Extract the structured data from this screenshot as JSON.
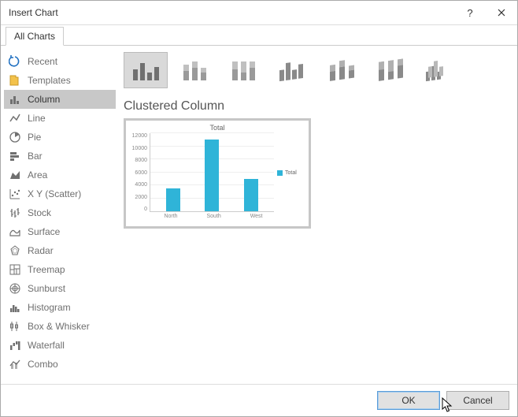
{
  "title": "Insert Chart",
  "tabs": {
    "main": "All Charts"
  },
  "sidebar": {
    "items": [
      {
        "label": "Recent"
      },
      {
        "label": "Templates"
      },
      {
        "label": "Column"
      },
      {
        "label": "Line"
      },
      {
        "label": "Pie"
      },
      {
        "label": "Bar"
      },
      {
        "label": "Area"
      },
      {
        "label": "X Y (Scatter)"
      },
      {
        "label": "Stock"
      },
      {
        "label": "Surface"
      },
      {
        "label": "Radar"
      },
      {
        "label": "Treemap"
      },
      {
        "label": "Sunburst"
      },
      {
        "label": "Histogram"
      },
      {
        "label": "Box & Whisker"
      },
      {
        "label": "Waterfall"
      },
      {
        "label": "Combo"
      }
    ]
  },
  "main": {
    "subtitle": "Clustered Column"
  },
  "footer": {
    "ok": "OK",
    "cancel": "Cancel"
  },
  "chart_data": {
    "type": "bar",
    "title": "Total",
    "categories": [
      "North",
      "South",
      "West"
    ],
    "values": [
      3500,
      11000,
      5000
    ],
    "ylabel": "",
    "xlabel": "",
    "ylim": [
      0,
      12000
    ],
    "yticks": [
      0,
      2000,
      4000,
      6000,
      8000,
      10000,
      12000
    ],
    "series": [
      {
        "name": "Total",
        "values": [
          3500,
          11000,
          5000
        ]
      }
    ]
  },
  "colors": {
    "accent": "#2fb4d8"
  }
}
